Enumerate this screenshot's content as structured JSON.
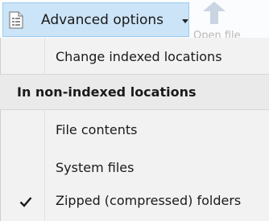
{
  "ribbon": {
    "advanced_button_label": "Advanced options",
    "advanced_button_icon": "document-list-icon",
    "open_file_label": "Open file",
    "open_file_icon": "open-file-icon"
  },
  "menu": {
    "change_indexed_label": "Change indexed locations",
    "section_header": "In non-indexed locations",
    "items": [
      {
        "label": "File contents",
        "checked": false
      },
      {
        "label": "System files",
        "checked": false
      },
      {
        "label": "Zipped (compressed) folders",
        "checked": true
      }
    ],
    "check_icon": "checkmark-icon"
  }
}
